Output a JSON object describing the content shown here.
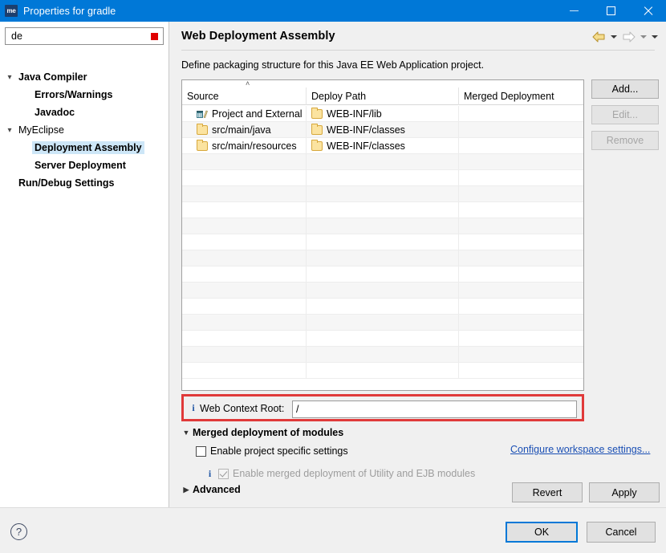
{
  "window": {
    "title": "Properties for gradle",
    "app_icon": "me",
    "icon_label": "myeclipse-icon",
    "controls": {
      "minimize": "minimize-icon",
      "maximize": "maximize-icon",
      "close": "close-icon"
    },
    "titlebar_color": "#0078d7"
  },
  "sidebar": {
    "filter": {
      "value": "de",
      "placeholder": "type filter text",
      "clear_icon": "clear-filter-icon",
      "clear_color": "#e00000"
    },
    "items": [
      {
        "label": "Java Compiler",
        "indent": 0,
        "expandable": true,
        "expanded": true,
        "bold": true,
        "selected": false
      },
      {
        "label": "Errors/Warnings",
        "indent": 1,
        "expandable": false,
        "expanded": false,
        "bold": true,
        "selected": false
      },
      {
        "label": "Javadoc",
        "indent": 1,
        "expandable": false,
        "expanded": false,
        "bold": true,
        "selected": false
      },
      {
        "label": "MyEclipse",
        "indent": 0,
        "expandable": true,
        "expanded": true,
        "bold": false,
        "selected": false
      },
      {
        "label": "Deployment Assembly",
        "indent": 1,
        "expandable": false,
        "expanded": false,
        "bold": true,
        "selected": true
      },
      {
        "label": "Server Deployment",
        "indent": 1,
        "expandable": false,
        "expanded": false,
        "bold": true,
        "selected": false
      },
      {
        "label": "Run/Debug Settings",
        "indent": 0,
        "expandable": false,
        "expanded": false,
        "bold": true,
        "selected": false
      }
    ]
  },
  "content": {
    "page_title": "Web Deployment Assembly",
    "description": "Define packaging structure for this Java EE Web Application project.",
    "nav": {
      "back_icon": "back-arrow-icon",
      "back_enabled": true,
      "back_color": "#e8c45a",
      "back_dropdown_icon": "chevron-down-icon",
      "forward_icon": "forward-arrow-icon",
      "forward_enabled": false,
      "forward_dropdown_icon": "chevron-down-icon",
      "menu_icon": "chevron-down-icon"
    }
  },
  "table": {
    "sort_indicator": "˄",
    "sorted_column": "Source",
    "columns": [
      "Source",
      "Deploy Path",
      "Merged Deployment"
    ],
    "rows": [
      {
        "source": "Project and External",
        "source_icon": "library-icon",
        "deploy_path": "WEB-INF/lib",
        "deploy_icon": "folder-icon",
        "merged": ""
      },
      {
        "source": "src/main/java",
        "source_icon": "folder-icon",
        "deploy_path": "WEB-INF/classes",
        "deploy_icon": "folder-icon",
        "merged": ""
      },
      {
        "source": "src/main/resources",
        "source_icon": "folder-icon",
        "deploy_path": "WEB-INF/classes",
        "deploy_icon": "folder-icon",
        "merged": ""
      }
    ],
    "empty_row_count": 14
  },
  "side_buttons": [
    {
      "label": "Add...",
      "enabled": true
    },
    {
      "label": "Edit...",
      "enabled": false
    },
    {
      "label": "Remove",
      "enabled": false
    }
  ],
  "web_context_root": {
    "info_icon": "info-icon",
    "label": "Web Context Root:",
    "value": "/",
    "highlight_color": "#e03a3a"
  },
  "merged_deployment": {
    "section_title": "Merged deployment of modules",
    "section_expanded": true,
    "expand_icon": "triangle-down-icon",
    "enable_project_specific": {
      "label": "Enable project specific settings",
      "checked": false,
      "enabled": true
    },
    "configure_link": "Configure workspace settings...",
    "merged_utility": {
      "info_icon": "info-icon",
      "label": "Enable merged deployment of Utility and EJB modules",
      "checked": true,
      "enabled": false
    }
  },
  "advanced": {
    "label": "Advanced",
    "expanded": false,
    "expand_icon": "triangle-right-icon"
  },
  "action_buttons": {
    "revert": "Revert",
    "apply": "Apply"
  },
  "footer": {
    "help_icon": "help-icon",
    "help_glyph": "?",
    "ok": "OK",
    "cancel": "Cancel",
    "focus_color": "#0078d7"
  }
}
